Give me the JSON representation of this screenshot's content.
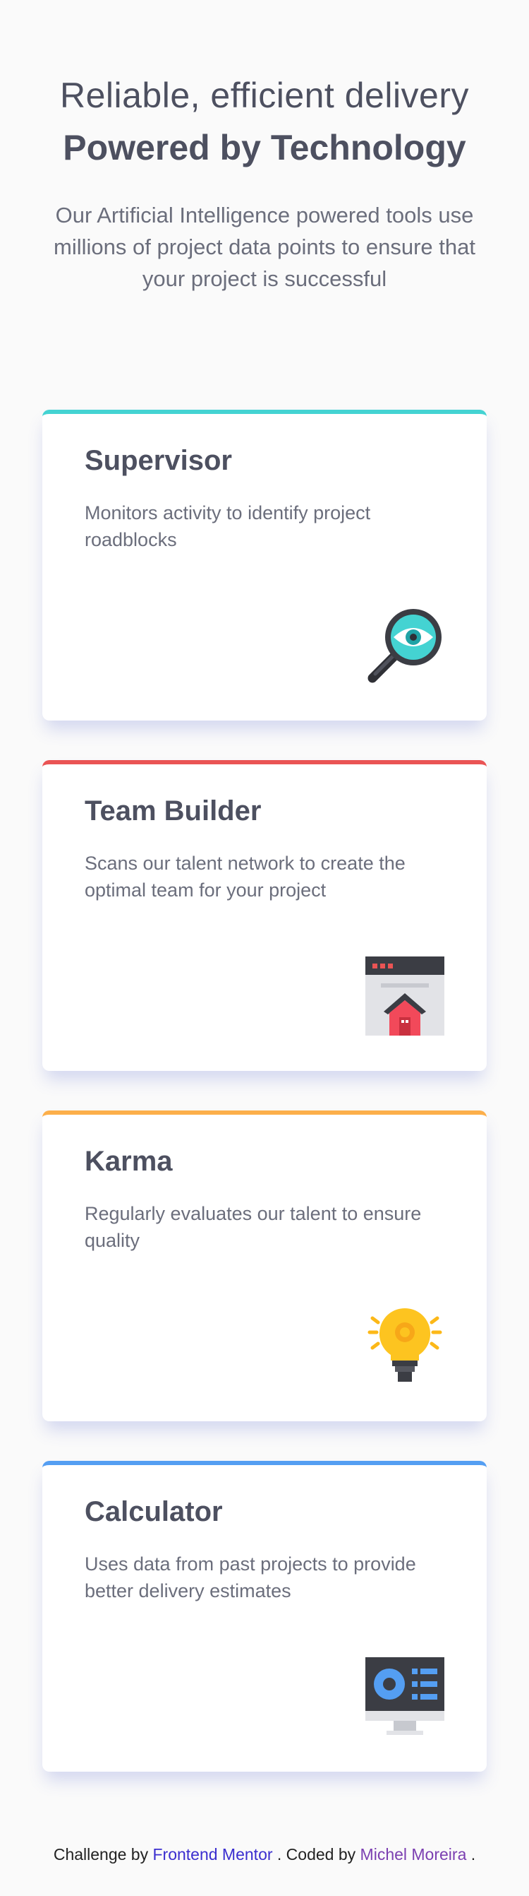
{
  "header": {
    "line1": "Reliable, efficient delivery",
    "line2": "Powered by Technology",
    "description": "Our Artificial Intelligence powered tools use millions of project data points to ensure that your project is successful"
  },
  "cards": [
    {
      "title": "Supervisor",
      "text": "Monitors activity to identify project roadblocks",
      "accent": "#44d3d2",
      "icon": "magnifier-eye-icon"
    },
    {
      "title": "Team Builder",
      "text": "Scans our talent network to create the optimal team for your project",
      "accent": "#ea5454",
      "icon": "browser-house-icon"
    },
    {
      "title": "Karma",
      "text": "Regularly evaluates our talent to ensure quality",
      "accent": "#fcaf4a",
      "icon": "lightbulb-icon"
    },
    {
      "title": "Calculator",
      "text": "Uses data from past projects to provide better delivery estimates",
      "accent": "#549ef2",
      "icon": "monitor-chart-icon"
    }
  ],
  "footer": {
    "prefix": "Challenge by",
    "challenge_link": "Frontend Mentor",
    "middle": ". Coded by",
    "author_link": "Michel Moreira",
    "suffix": "."
  }
}
